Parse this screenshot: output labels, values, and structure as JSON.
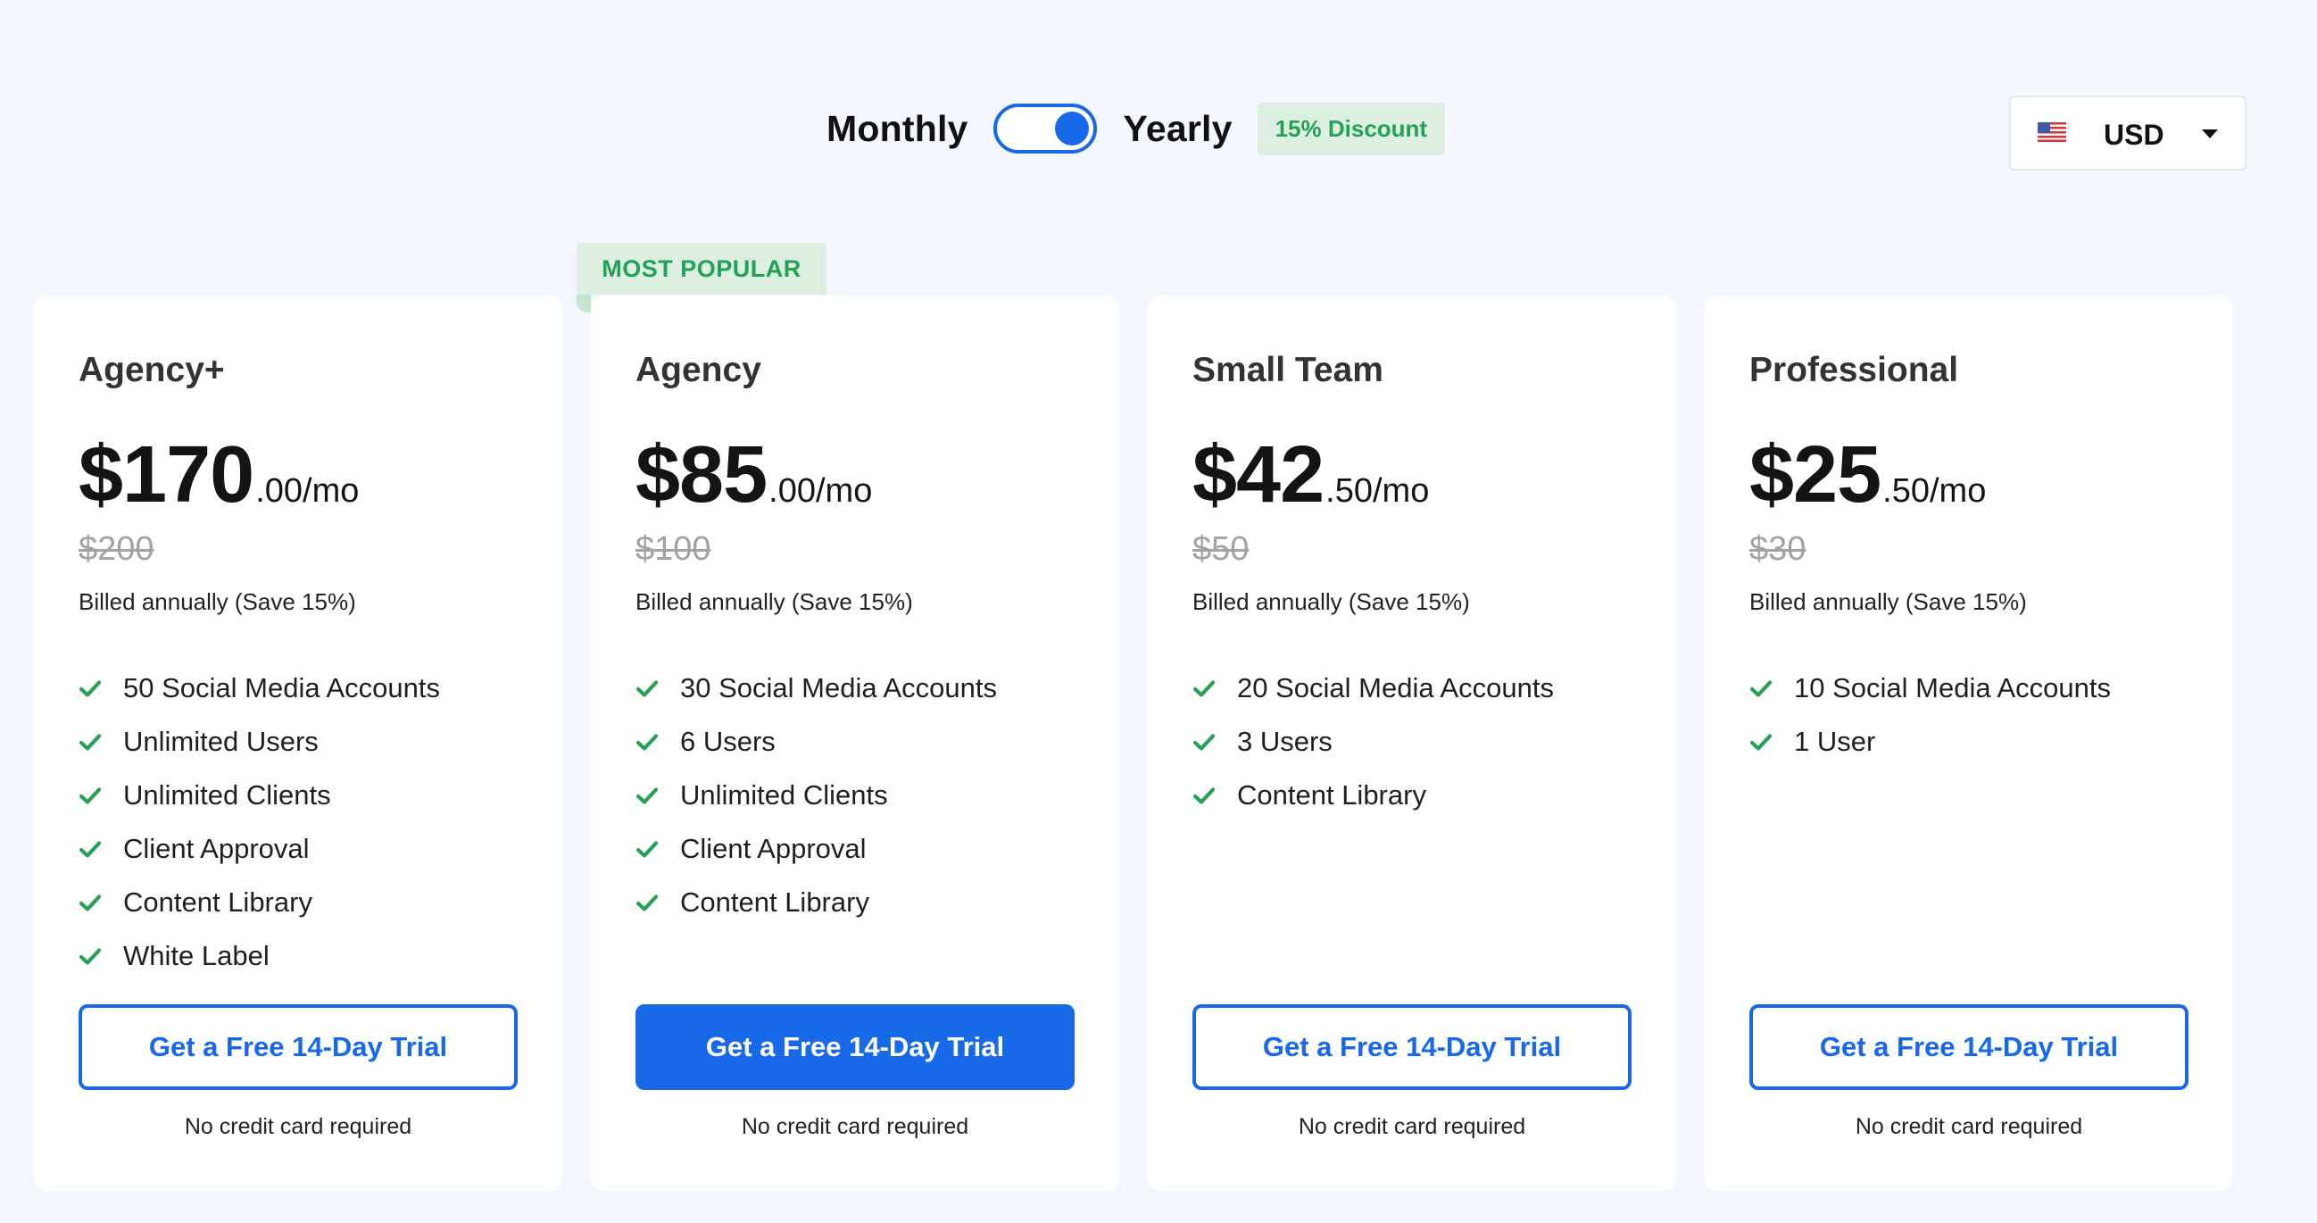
{
  "billing": {
    "monthly_label": "Monthly",
    "yearly_label": "Yearly",
    "selected": "Yearly",
    "discount_badge": "15% Discount"
  },
  "currency": {
    "value": "USD",
    "flag_icon": "us-flag-icon"
  },
  "popular_label": "MOST POPULAR",
  "colors": {
    "primary": "#1769e8",
    "success": "#23a05a",
    "badge_bg": "#dcefe1",
    "page_bg": "#f3f7fd"
  },
  "plans": [
    {
      "name": "Agency+",
      "price_whole": "$170",
      "price_fraction": ".00/mo",
      "old_price": "$200",
      "billing_note": "Billed annually (Save 15%)",
      "features": [
        "50 Social Media Accounts",
        "Unlimited Users",
        "Unlimited Clients",
        "Client Approval",
        "Content Library",
        "White Label"
      ],
      "cta": "Get a Free 14-Day Trial",
      "footnote": "No credit card required"
    },
    {
      "name": "Agency",
      "price_whole": "$85",
      "price_fraction": ".00/mo",
      "old_price": "$100",
      "billing_note": "Billed annually (Save 15%)",
      "features": [
        "30 Social Media Accounts",
        "6 Users",
        "Unlimited Clients",
        "Client Approval",
        "Content Library"
      ],
      "cta": "Get a Free 14-Day Trial",
      "footnote": "No credit card required",
      "most_popular": true
    },
    {
      "name": "Small Team",
      "price_whole": "$42",
      "price_fraction": ".50/mo",
      "old_price": "$50",
      "billing_note": "Billed annually (Save 15%)",
      "features": [
        "20 Social Media Accounts",
        "3 Users",
        "Content Library"
      ],
      "cta": "Get a Free 14-Day Trial",
      "footnote": "No credit card required"
    },
    {
      "name": "Professional",
      "price_whole": "$25",
      "price_fraction": ".50/mo",
      "old_price": "$30",
      "billing_note": "Billed annually (Save 15%)",
      "features": [
        "10 Social Media Accounts",
        "1 User"
      ],
      "cta": "Get a Free 14-Day Trial",
      "footnote": "No credit card required"
    }
  ]
}
